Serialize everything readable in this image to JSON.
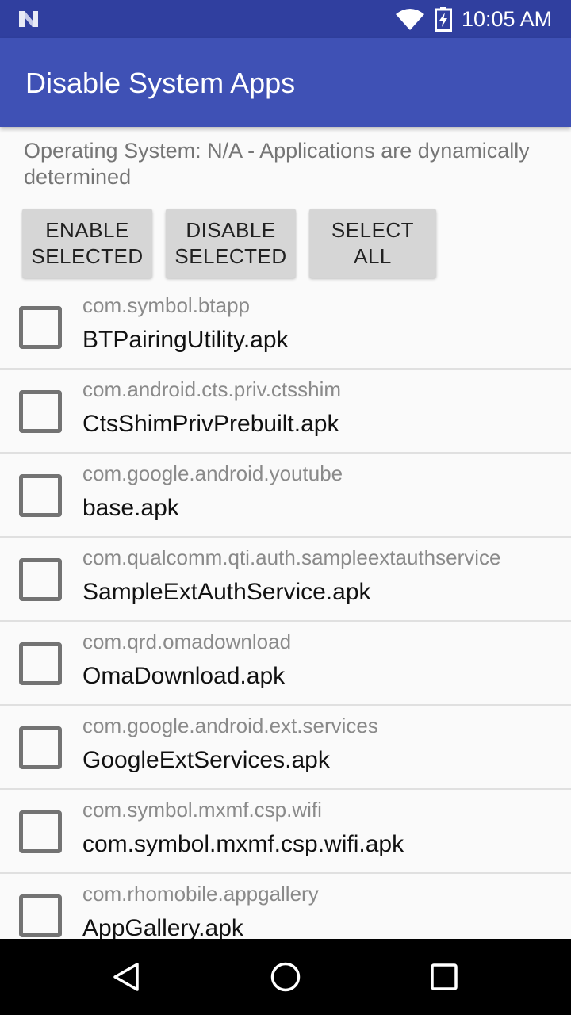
{
  "status_bar": {
    "time": "10:05 AM",
    "icons": [
      "notification-n-icon",
      "wifi-icon",
      "battery-charging-icon"
    ]
  },
  "app_bar": {
    "title": "Disable System Apps",
    "color": "#3f51b5",
    "status_color": "#303f9f"
  },
  "os_info": "Operating System: N/A - Applications are dynamically determined",
  "buttons": {
    "enable": "ENABLE\nSELECTED",
    "disable": "DISABLE\nSELECTED",
    "select_all": "SELECT\nALL"
  },
  "apps": [
    {
      "package": "com.symbol.btapp",
      "apk": "BTPairingUtility.apk",
      "checked": false
    },
    {
      "package": "com.android.cts.priv.ctsshim",
      "apk": "CtsShimPrivPrebuilt.apk",
      "checked": false
    },
    {
      "package": "com.google.android.youtube",
      "apk": "base.apk",
      "checked": false
    },
    {
      "package": "com.qualcomm.qti.auth.sampleextauthservice",
      "apk": "SampleExtAuthService.apk",
      "checked": false
    },
    {
      "package": "com.qrd.omadownload",
      "apk": "OmaDownload.apk",
      "checked": false
    },
    {
      "package": "com.google.android.ext.services",
      "apk": "GoogleExtServices.apk",
      "checked": false
    },
    {
      "package": "com.symbol.mxmf.csp.wifi",
      "apk": "com.symbol.mxmf.csp.wifi.apk",
      "checked": false
    },
    {
      "package": "com.rhomobile.appgallery",
      "apk": "AppGallery.apk",
      "checked": false
    }
  ],
  "nav_bar": {
    "icons": [
      "back-icon",
      "home-icon",
      "recents-icon"
    ]
  }
}
